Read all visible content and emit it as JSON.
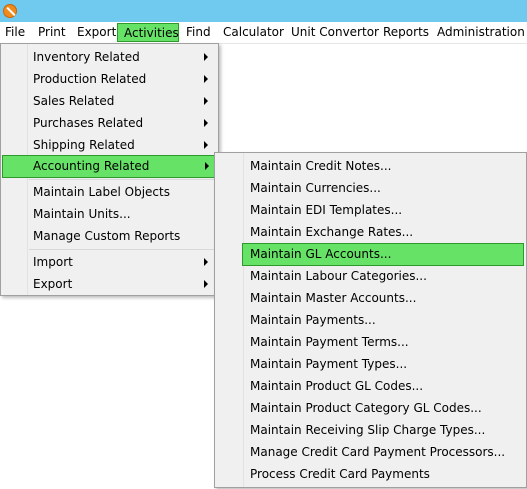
{
  "colors": {
    "titlebar": "#70c9ef",
    "highlight": "#66e266",
    "highlight_border": "#2e9a2e",
    "menu_bg": "#f0f0f0"
  },
  "app": {
    "icon": "app-logo-icon"
  },
  "menubar": {
    "items": [
      "File",
      "Print",
      "Export",
      "Activities",
      "Find",
      "Calculator",
      "Unit Convertor",
      "Reports",
      "Administration"
    ],
    "active": "Activities"
  },
  "activities_menu": {
    "items": [
      "Inventory Related",
      "Production Related",
      "Sales Related",
      "Purchases Related",
      "Shipping Related",
      "Accounting Related",
      "Maintain Label Objects",
      "Maintain Units...",
      "Manage Custom Reports",
      "Import",
      "Export"
    ],
    "highlighted": "Accounting Related"
  },
  "accounting_menu": {
    "items": [
      "Maintain Credit Notes...",
      "Maintain Currencies...",
      "Maintain EDI Templates...",
      "Maintain Exchange Rates...",
      "Maintain GL Accounts...",
      "Maintain Labour Categories...",
      "Maintain Master Accounts...",
      "Maintain Payments...",
      "Maintain Payment Terms...",
      "Maintain Payment Types...",
      "Maintain Product GL Codes...",
      "Maintain Product Category GL Codes...",
      "Maintain Receiving Slip Charge Types...",
      "Manage Credit Card Payment Processors...",
      "Process Credit Card Payments"
    ],
    "highlighted": "Maintain GL Accounts..."
  }
}
